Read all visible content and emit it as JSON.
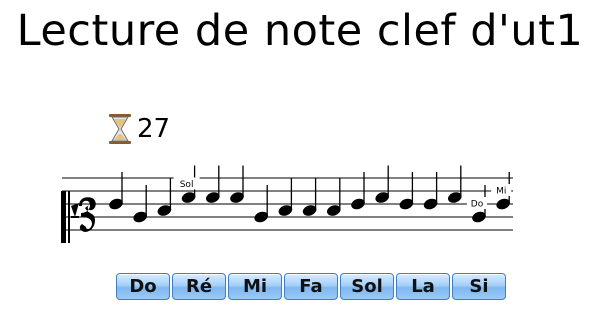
{
  "title": "Lecture de note clef d'ut1",
  "timer": {
    "icon": "hourglass-icon",
    "remaining": "27"
  },
  "staff": {
    "clef": "c-clef-line-1",
    "notes": [
      {
        "pos": 3,
        "label": ""
      },
      {
        "pos": 1,
        "label": ""
      },
      {
        "pos": 2,
        "label": ""
      },
      {
        "pos": 4,
        "label": "Sol"
      },
      {
        "pos": 4,
        "label": ""
      },
      {
        "pos": 4,
        "label": ""
      },
      {
        "pos": 1,
        "label": ""
      },
      {
        "pos": 2,
        "label": ""
      },
      {
        "pos": 2,
        "label": ""
      },
      {
        "pos": 2,
        "label": ""
      },
      {
        "pos": 3,
        "label": ""
      },
      {
        "pos": 4,
        "label": ""
      },
      {
        "pos": 3,
        "label": ""
      },
      {
        "pos": 3,
        "label": ""
      },
      {
        "pos": 4,
        "label": ""
      },
      {
        "pos": 1,
        "label": "Do"
      },
      {
        "pos": 3,
        "label": "Mi"
      }
    ]
  },
  "answers": [
    "Do",
    "Ré",
    "Mi",
    "Fa",
    "Sol",
    "La",
    "Si"
  ]
}
